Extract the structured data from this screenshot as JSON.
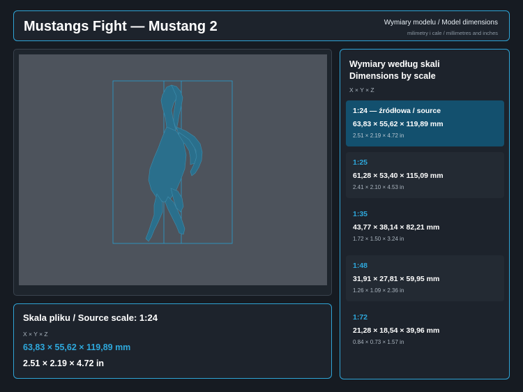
{
  "header": {
    "title": "Mustangs Fight — Mustang 2",
    "subtitle_line1": "Wymiary modelu / Model dimensions",
    "subtitle_line2": "milimetry i cale / millimetres and inches"
  },
  "source": {
    "title": "Skala pliku / Source scale: 1:24",
    "axes": "X × Y × Z",
    "dims_mm": "63,83 × 55,62 × 119,89 mm",
    "dims_in": "2.51 × 2.19 × 4.72 in"
  },
  "scales": {
    "title_line1": "Wymiary według skali",
    "title_line2": "Dimensions by scale",
    "axes": "X × Y × Z",
    "items": [
      {
        "label": "1:24  —  źródłowa / source",
        "mm": "63,83 × 55,62 × 119,89 mm",
        "in": "2.51 × 2.19 × 4.72 in"
      },
      {
        "label": "1:25",
        "mm": "61,28 × 53,40 × 115,09 mm",
        "in": "2.41 × 2.10 × 4.53 in"
      },
      {
        "label": "1:35",
        "mm": "43,77 × 38,14 × 82,21 mm",
        "in": "1.72 × 1.50 × 3.24 in"
      },
      {
        "label": "1:48",
        "mm": "31,91 × 27,81 × 59,95 mm",
        "in": "1.26 × 1.09 × 2.36 in"
      },
      {
        "label": "1:72",
        "mm": "21,28 × 18,54 × 39,96 mm",
        "in": "0.84 × 0.73 × 1.57 in"
      }
    ]
  },
  "colors": {
    "accent": "#2ea8dc",
    "active_card": "#13506e",
    "model": "#2a6f8c",
    "viewport_bg": "#4d535c"
  },
  "viewport": {
    "model_icon": "horse-model-icon",
    "bbox_icon": "bounding-box-icon"
  }
}
